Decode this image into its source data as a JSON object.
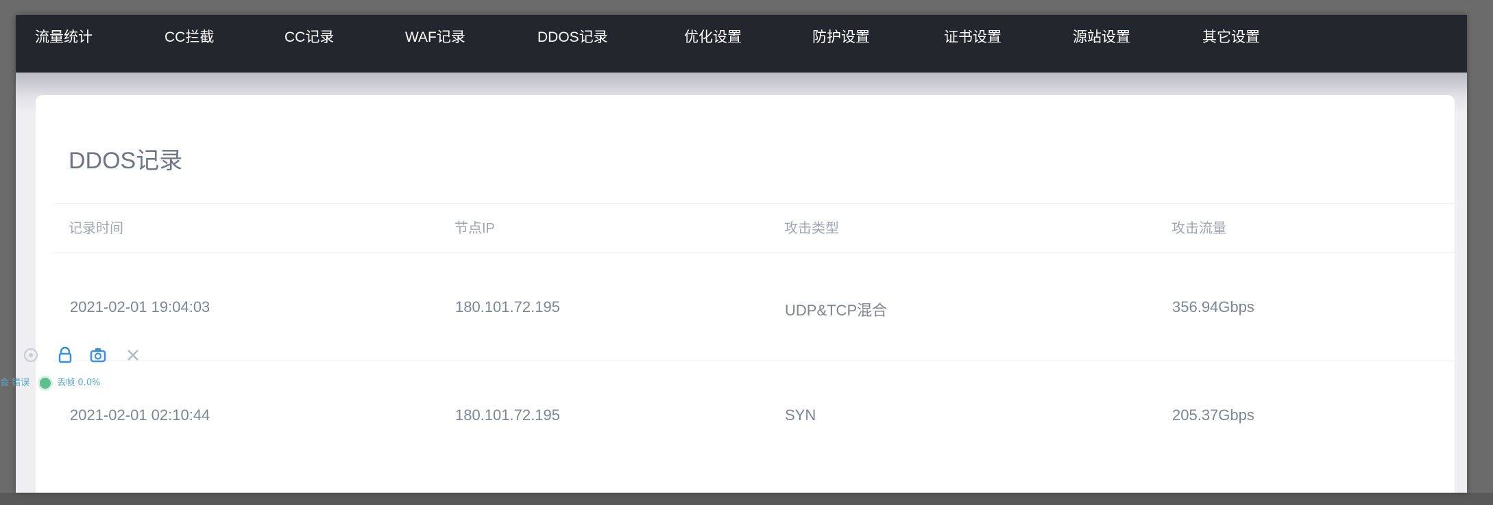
{
  "nav": {
    "items": [
      {
        "label": "流量统计"
      },
      {
        "label": "CC拦截"
      },
      {
        "label": "CC记录"
      },
      {
        "label": "WAF记录"
      },
      {
        "label": "DDOS记录"
      },
      {
        "label": "优化设置"
      },
      {
        "label": "防护设置"
      },
      {
        "label": "证书设置"
      },
      {
        "label": "源站设置"
      },
      {
        "label": "其它设置"
      }
    ]
  },
  "page": {
    "title": "DDOS记录"
  },
  "table": {
    "columns": [
      "记录时间",
      "节点IP",
      "攻击类型",
      "攻击流量"
    ],
    "rows": [
      [
        "2021-02-01 19:04:03",
        "180.101.72.195",
        "UDP&TCP混合",
        "356.94Gbps"
      ],
      [
        "2021-02-01 02:10:44",
        "180.101.72.195",
        "SYN",
        "205.37Gbps"
      ]
    ]
  },
  "overlay": {
    "status_left": "会 错误",
    "status_text": "丢帧 0.0%"
  },
  "colors": {
    "nav_bg": "#23262c",
    "accent_icon": "#3a8fd9",
    "status_green": "#5fbf8a"
  }
}
